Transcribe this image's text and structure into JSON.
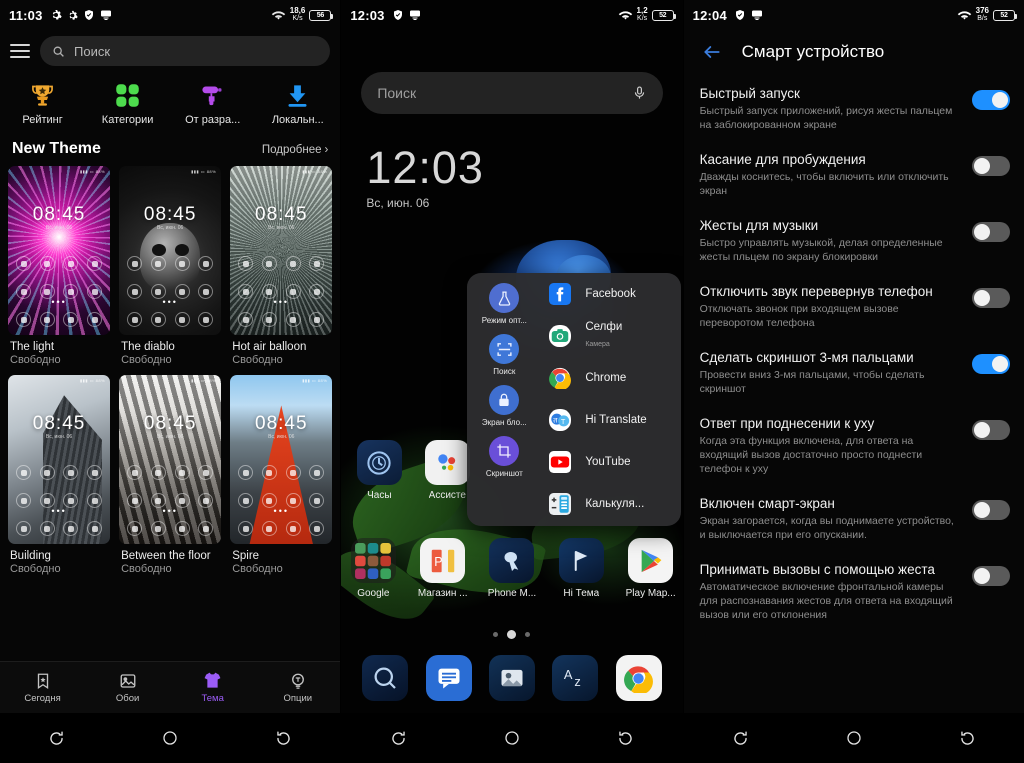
{
  "panel1": {
    "status": {
      "time": "11:03",
      "rate_value": "18,6",
      "rate_unit": "K/s",
      "battery": "56",
      "icons": [
        "gear-icon",
        "gear-icon",
        "shield-icon",
        "monitor-icon",
        "wifi-icon"
      ]
    },
    "search": {
      "placeholder": "Поиск",
      "icon": "search-icon"
    },
    "menu_icon": "hamburger-icon",
    "quick_links": [
      {
        "label": "Рейтинг",
        "icon": "trophy-icon"
      },
      {
        "label": "Категории",
        "icon": "clover-icon"
      },
      {
        "label": "От разра...",
        "icon": "paint-roller-icon"
      },
      {
        "label": "Локальн...",
        "icon": "download-icon"
      }
    ],
    "section": {
      "title": "New Theme",
      "more": "Подробнее",
      "more_icon": "chevron-right-icon"
    },
    "themes": [
      {
        "name": "The light",
        "price": "Свободно",
        "clock": "08:45",
        "sub": "Вс, июн. 06",
        "art": "art-light"
      },
      {
        "name": "The diablo",
        "price": "Свободно",
        "clock": "08:45",
        "sub": "Вс, июн. 06",
        "art": "art-diablo"
      },
      {
        "name": "Hot air balloon",
        "price": "Свободно",
        "clock": "08:45",
        "sub": "Вс, июн. 06",
        "art": "art-balloon"
      },
      {
        "name": "Building",
        "price": "Свободно",
        "clock": "08:45",
        "sub": "Вс, июн. 06",
        "art": "art-building"
      },
      {
        "name": "Between the floor",
        "price": "Свободно",
        "clock": "08:45",
        "sub": "Вс, июн. 06",
        "art": "art-floor"
      },
      {
        "name": "Spire",
        "price": "Свободно",
        "clock": "08:45",
        "sub": "Вс, июн. 06",
        "art": "art-spire"
      }
    ],
    "tabs": [
      {
        "label": "Сегодня",
        "icon": "bookmark-star-icon",
        "active": false
      },
      {
        "label": "Обои",
        "icon": "image-icon",
        "active": false
      },
      {
        "label": "Тема",
        "icon": "tshirt-icon",
        "active": true
      },
      {
        "label": "Опции",
        "icon": "bulb-icon",
        "active": false
      }
    ],
    "accent": "#9b5cf6",
    "nav": [
      "recent-icon",
      "home-icon",
      "back-icon"
    ]
  },
  "panel2": {
    "status": {
      "time": "12:03",
      "rate_value": "1,2",
      "rate_unit": "K/s",
      "battery": "52",
      "icons": [
        "shield-icon",
        "monitor-icon",
        "wifi-icon"
      ]
    },
    "search": {
      "placeholder": "Поиск",
      "mic_icon": "microphone-icon"
    },
    "clock": {
      "time": "12:03",
      "date": "Вс, июн. 06"
    },
    "home_icons": [
      {
        "label": "Часы",
        "icon": "clock-app-icon"
      },
      {
        "label": "Ассисте",
        "icon": "assistant-icon"
      }
    ],
    "dock_row": [
      {
        "label": "Google",
        "icon": "google-folder-icon"
      },
      {
        "label": "Магазин ...",
        "icon": "store-icon"
      },
      {
        "label": "Phone M...",
        "icon": "phone-manager-icon"
      },
      {
        "label": "Hi Тема",
        "icon": "hi-theme-icon"
      },
      {
        "label": "Play Mар...",
        "icon": "play-store-icon"
      }
    ],
    "bottom_dock": [
      {
        "icon": "search-app-icon"
      },
      {
        "icon": "messages-icon"
      },
      {
        "icon": "gallery-icon"
      },
      {
        "icon": "dictionary-icon"
      },
      {
        "icon": "chrome-icon"
      }
    ],
    "page_dots": 3,
    "active_dot": 2,
    "popup": {
      "tools": [
        {
          "label": "Режим опт...",
          "icon": "flask-icon"
        },
        {
          "label": "Поиск",
          "icon": "scan-icon"
        },
        {
          "label": "Экран бло...",
          "icon": "lock-icon"
        },
        {
          "label": "Скриншот",
          "icon": "crop-icon"
        }
      ],
      "apps": [
        {
          "name": "Facebook",
          "sub": "",
          "icon": "facebook-icon"
        },
        {
          "name": "Селфи",
          "sub": "Камера",
          "icon": "camera-icon"
        },
        {
          "name": "Chrome",
          "sub": "",
          "icon": "chrome-icon"
        },
        {
          "name": "Hi Translate",
          "sub": "",
          "icon": "translate-icon"
        },
        {
          "name": "YouTube",
          "sub": "",
          "icon": "youtube-icon"
        },
        {
          "name": "Калькуля...",
          "sub": "",
          "icon": "calculator-icon"
        }
      ]
    },
    "nav": [
      "recent-icon",
      "home-icon",
      "back-icon"
    ]
  },
  "panel3": {
    "status": {
      "time": "12:04",
      "rate_value": "376",
      "rate_unit": "B/s",
      "battery": "52",
      "icons": [
        "shield-icon",
        "monitor-icon",
        "wifi-icon"
      ]
    },
    "header": {
      "title": "Смарт устройство",
      "back_icon": "back-arrow-icon"
    },
    "settings": [
      {
        "title": "Быстрый запуск",
        "desc": "Быстрый запуск приложений, рисуя жесты пальцем на заблокированном экране",
        "on": true
      },
      {
        "title": "Касание для пробуждения",
        "desc": "Дважды коснитесь, чтобы включить или отключить экран",
        "on": false
      },
      {
        "title": "Жесты для музыки",
        "desc": "Быстро управлять музыкой, делая определенные жесты пльцем по экрану блокировки",
        "on": false
      },
      {
        "title": "Отключить звук перевернув телефон",
        "desc": "Отключать звонок при входящем вызове переворотом телефона",
        "on": false
      },
      {
        "title": "Сделать скриншот 3-мя пальцами",
        "desc": "Провести вниз 3-мя пальцами, чтобы сделать скриншот",
        "on": true
      },
      {
        "title": "Ответ при поднесении к уху",
        "desc": "Когда эта функция включена, для ответа на входящий вызов достаточно просто поднести телефон к уху",
        "on": false
      },
      {
        "title": "Включен смарт-экран",
        "desc": "Экран загорается, когда вы поднимаете устройство, и выключается при его опускании.",
        "on": false
      },
      {
        "title": "Принимать вызовы с помощью жеста",
        "desc": "Автоматическое включение фронтальной камеры для распознавания жестов для ответа на входящий вызов или его отклонения",
        "on": false
      }
    ],
    "toggle_on_color": "#1e90ff",
    "toggle_off_color": "#5a5a5a",
    "nav": [
      "recent-icon",
      "home-icon",
      "back-icon"
    ]
  }
}
